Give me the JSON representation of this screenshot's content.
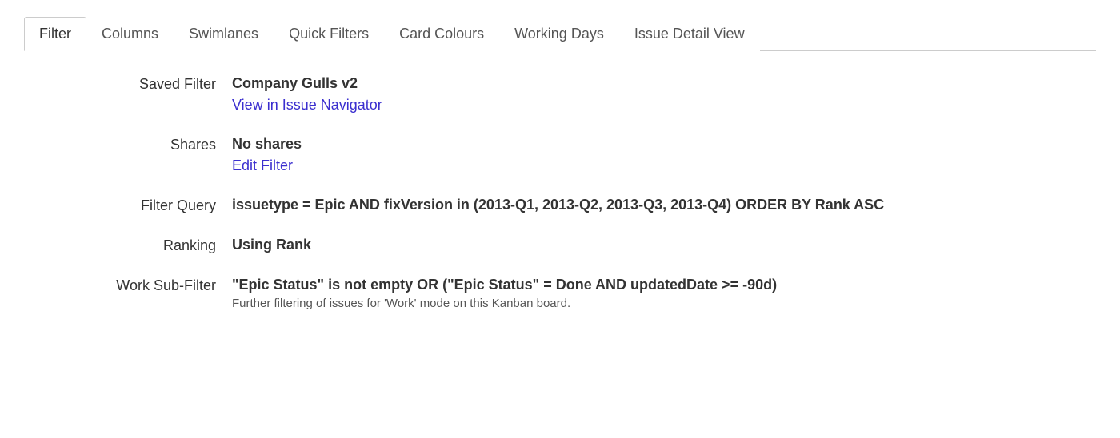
{
  "tabs": [
    {
      "label": "Filter",
      "active": true
    },
    {
      "label": "Columns",
      "active": false
    },
    {
      "label": "Swimlanes",
      "active": false
    },
    {
      "label": "Quick Filters",
      "active": false
    },
    {
      "label": "Card Colours",
      "active": false
    },
    {
      "label": "Working Days",
      "active": false
    },
    {
      "label": "Issue Detail View",
      "active": false
    }
  ],
  "filter": {
    "saved_filter_label": "Saved Filter",
    "saved_filter_value": "Company Gulls v2",
    "view_in_issue_navigator": "View in Issue Navigator",
    "shares_label": "Shares",
    "shares_value": "No shares",
    "edit_filter": "Edit Filter",
    "filter_query_label": "Filter Query",
    "filter_query_value": "issuetype = Epic AND fixVersion in (2013-Q1, 2013-Q2, 2013-Q3, 2013-Q4) ORDER BY Rank ASC",
    "ranking_label": "Ranking",
    "ranking_value": "Using Rank",
    "work_sub_filter_label": "Work Sub-Filter",
    "work_sub_filter_value": "\"Epic Status\" is not empty OR (\"Epic Status\" = Done AND updatedDate >= -90d)",
    "work_sub_filter_helper": "Further filtering of issues for 'Work' mode on this Kanban board."
  }
}
